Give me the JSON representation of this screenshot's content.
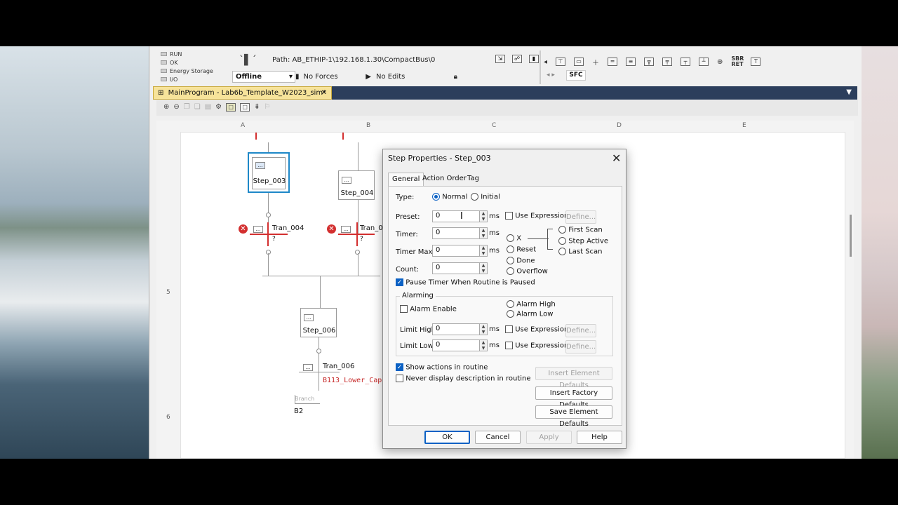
{
  "status": {
    "items": [
      "RUN",
      "OK",
      "Energy Storage",
      "I/O"
    ],
    "mode": "Offline",
    "forces": "No Forces",
    "edits": "No Edits",
    "path_label": "Path:",
    "path_value": "AB_ETHIP-1\\192.168.1.30\\CompactBus\\0"
  },
  "sfc_toolbar": {
    "tab": "SFC",
    "sbr_ret": "SBR RET"
  },
  "document_tab": {
    "title": "MainProgram - Lab6b_Template_W2023_sim*",
    "close": "✕"
  },
  "grid": {
    "columns": [
      "A",
      "B",
      "C",
      "D",
      "E"
    ],
    "rows": [
      "5",
      "6"
    ]
  },
  "sfc": {
    "step_003": "Step_003",
    "step_004": "Step_004",
    "step_006": "Step_006",
    "tran_004": "Tran_004",
    "tran_005": "Tran_0",
    "tran_006": "Tran_006",
    "tran_q": "?",
    "mini_btn": "...",
    "tran_006_expr": "B113_Lower_Cap",
    "branch_label": "Branch",
    "branch_id": "B2"
  },
  "dialog": {
    "title": "Step Properties - Step_003",
    "close": "✕",
    "tabs": [
      "General",
      "Action Order",
      "Tag"
    ],
    "type_label": "Type:",
    "type_options": [
      "Normal",
      "Initial"
    ],
    "preset_label": "Preset:",
    "preset_value": "0",
    "timer_label": "Timer:",
    "timer_value": "0",
    "timer_max_label": "Timer Max:",
    "timer_max_value": "0",
    "count_label": "Count:",
    "count_value": "0",
    "ms": "ms",
    "use_expression": "Use Expression",
    "define": "Define...",
    "bits": [
      "X",
      "Reset",
      "Done",
      "Overflow"
    ],
    "scan_options": [
      "First Scan",
      "Step Active",
      "Last Scan"
    ],
    "pause_timer": "Pause Timer When Routine is Paused",
    "alarming": "Alarming",
    "alarm_enable": "Alarm Enable",
    "alarm_high": "Alarm High",
    "alarm_low": "Alarm Low",
    "limit_high_label": "Limit High:",
    "limit_high_value": "0",
    "limit_low_label": "Limit Low:",
    "limit_low_value": "0",
    "show_actions": "Show actions in routine",
    "never_display": "Never display description in routine",
    "insert_element_defaults": "Insert Element Defaults",
    "insert_factory_defaults": "Insert Factory Defaults",
    "save_element_defaults": "Save Element Defaults",
    "ok": "OK",
    "cancel": "Cancel",
    "apply": "Apply",
    "help": "Help"
  },
  "colors": {
    "accent": "#0b61c4",
    "tab_bar": "#2c3e5c",
    "doc_tab": "#f7e39a",
    "error_red": "#d32f2f",
    "step_selected": "#1e88c8"
  }
}
